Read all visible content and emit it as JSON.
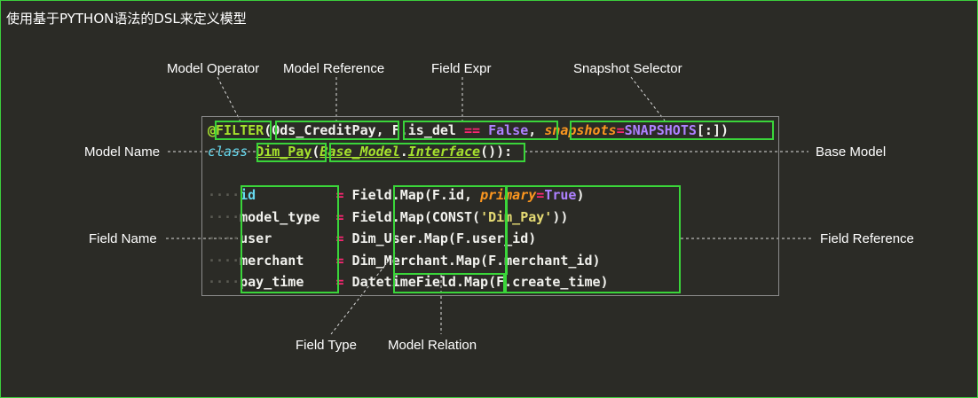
{
  "title": "使用基于PYTHON语法的DSL来定义模型",
  "labels": {
    "model_operator": "Model Operator",
    "model_reference": "Model Reference",
    "field_expr": "Field Expr",
    "snapshot_selector": "Snapshot Selector",
    "model_name": "Model Name",
    "base_model": "Base Model",
    "field_name": "Field Name",
    "field_reference": "Field Reference",
    "field_type": "Field Type",
    "model_relation": "Model Relation"
  },
  "code": {
    "line1": {
      "at": "@",
      "operator": "FILTER",
      "open": "(",
      "model_ref": "Ods_CreditPay",
      "comma1": ", ",
      "field_expr_a": "F.is_del ",
      "eq": "==",
      "space": " ",
      "false_kw": "False",
      "comma2": ", ",
      "snap_kw": "snapshots",
      "snap_eq": "=",
      "snap_val": "SNAPSHOTS",
      "slice": "[:]",
      "close": ")"
    },
    "line2": {
      "class_kw": "class",
      "space": " ",
      "name": "Dim_Pay",
      "open": "(",
      "base_a": "Base_Model",
      "dot": ".",
      "base_b": "Interface",
      "call": "()",
      "close": "):"
    },
    "fields": [
      {
        "name": "id",
        "pad": "          ",
        "eq": "=",
        "expr_a": " Field.Map(F.",
        "expr_b": "id, ",
        "kw": "primary",
        "kw_eq": "=",
        "kw_val": "True",
        "tail": ")"
      },
      {
        "name": "model_type",
        "pad": "  ",
        "eq": "=",
        "expr_a": " Field.Map(CONST(",
        "str": "'Dim_Pay'",
        "tail": "))"
      },
      {
        "name": "user",
        "pad": "        ",
        "eq": "=",
        "expr_a": " Dim_User.Map(F.user_id)"
      },
      {
        "name": "merchant",
        "pad": "    ",
        "eq": "=",
        "expr_a": " Dim_Merchant.Map(F.merchant_id)"
      },
      {
        "name": "pay_time",
        "pad": "    ",
        "eq": "=",
        "expr_a": " DatetimeField.Map(F.create_time)"
      }
    ],
    "indent": "····"
  },
  "colors": {
    "background": "#2b2b26",
    "highlight_box": "#3ad53a",
    "frame": "#3ccf3c",
    "text": "#f2f2ee"
  }
}
